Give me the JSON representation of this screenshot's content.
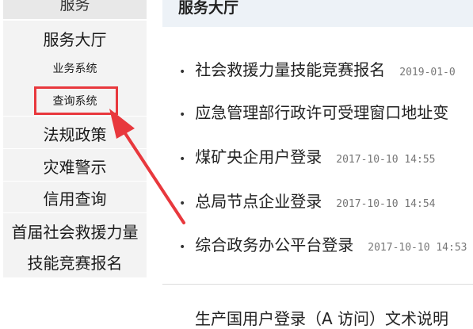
{
  "sidebar": {
    "header": "服务",
    "items": [
      {
        "label": "服务大厅",
        "size": "big"
      },
      {
        "label": "业务系统",
        "size": "small"
      },
      {
        "label": "查询系统",
        "size": "small"
      },
      {
        "label": "法规政策",
        "size": "big"
      },
      {
        "label": "灾难警示",
        "size": "big"
      },
      {
        "label": "信用查询",
        "size": "big"
      },
      {
        "label": "首届社会救援力量",
        "size": "big"
      },
      {
        "label": "技能竞赛报名",
        "size": "big"
      }
    ]
  },
  "main": {
    "title": "服务大厅",
    "news": [
      {
        "title": "社会救援力量技能竞赛报名",
        "date": "2019-01-0"
      },
      {
        "title": "应急管理部行政许可受理窗口地址变",
        "date": ""
      },
      {
        "title": "煤矿央企用户登录",
        "date": "2017-10-10 14:55"
      },
      {
        "title": "总局节点企业登录",
        "date": "2017-10-10 14:54"
      },
      {
        "title": "综合政务办公平台登录",
        "date": "2017-10-10 14:53"
      }
    ],
    "cut_off_text": "生产国用户登录（A 访问）文术说明"
  },
  "annotation": {
    "color": "#e8383d"
  }
}
